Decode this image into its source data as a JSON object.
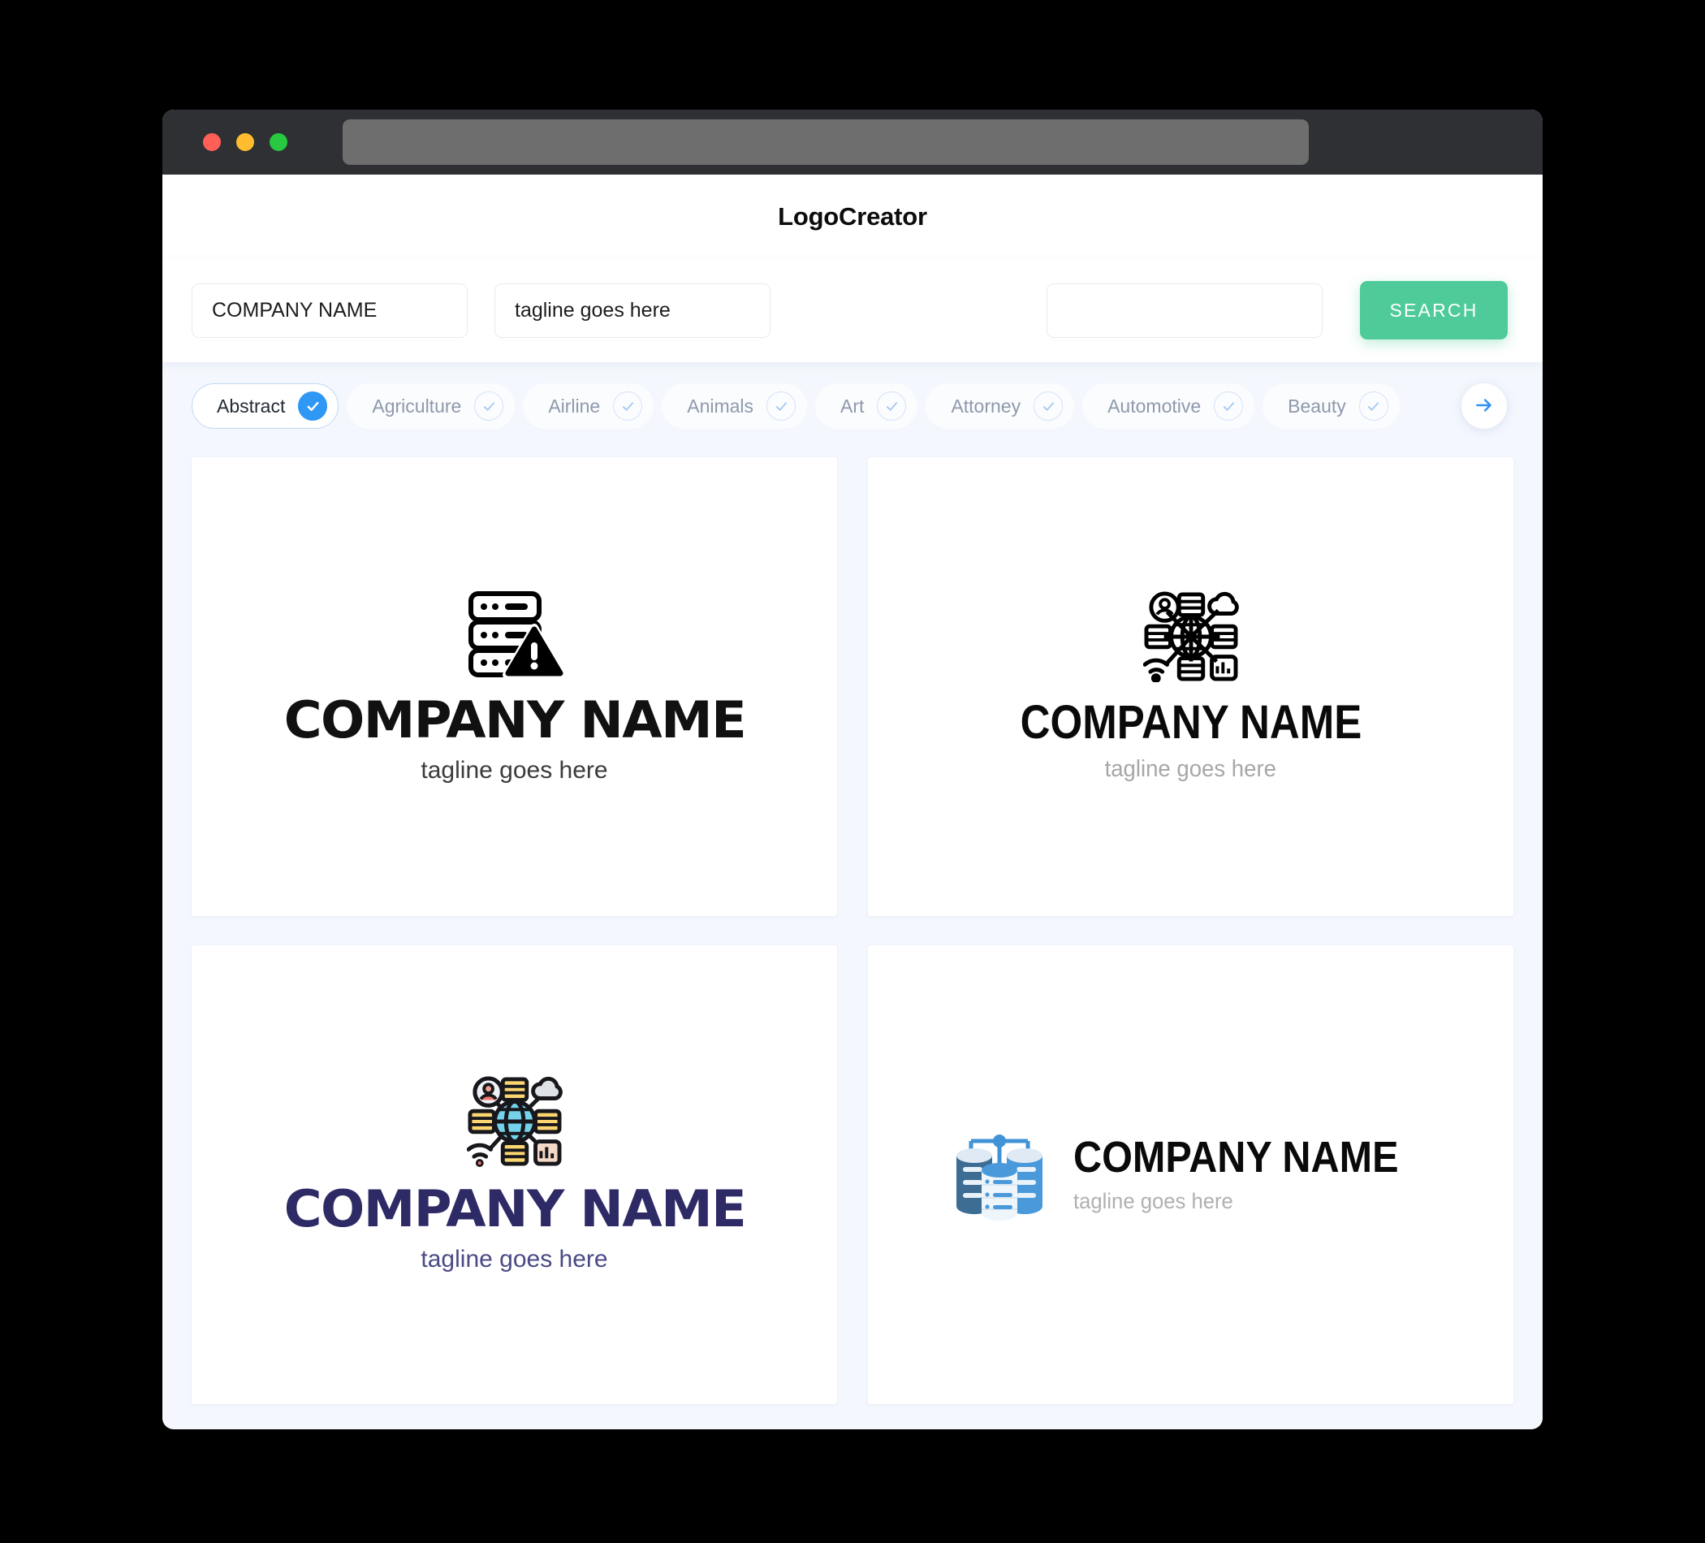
{
  "window": {
    "traffic_lights": [
      "close",
      "minimize",
      "zoom"
    ],
    "url_value": ""
  },
  "header": {
    "title": "LogoCreator"
  },
  "search": {
    "company_name": {
      "value": "COMPANY NAME",
      "placeholder": "COMPANY NAME"
    },
    "tagline": {
      "value": "tagline goes here",
      "placeholder": "tagline goes here"
    },
    "extra": {
      "value": "",
      "placeholder": ""
    },
    "search_label": "SEARCH",
    "accent_color": "#4ecb98"
  },
  "categories": {
    "items": [
      {
        "label": "Abstract",
        "selected": true
      },
      {
        "label": "Agriculture",
        "selected": false
      },
      {
        "label": "Airline",
        "selected": false
      },
      {
        "label": "Animals",
        "selected": false
      },
      {
        "label": "Art",
        "selected": false
      },
      {
        "label": "Attorney",
        "selected": false
      },
      {
        "label": "Automotive",
        "selected": false
      },
      {
        "label": "Beauty",
        "selected": false
      }
    ],
    "next_icon": "arrow-right-icon",
    "selected_color": "#2f97f4"
  },
  "results": {
    "cards": [
      {
        "mark": "server-warning-icon",
        "brand": "COMPANY NAME",
        "tagline": "tagline goes here",
        "brand_color": "#111111",
        "tagline_color": "#3b3b3b"
      },
      {
        "mark": "network-globe-icon",
        "brand": "COMPANY NAME",
        "tagline": "tagline goes here",
        "brand_color": "#0a0a0a",
        "tagline_color": "#a7a7a7"
      },
      {
        "mark": "network-globe-color-icon",
        "brand": "COMPANY NAME",
        "tagline": "tagline goes here",
        "brand_color": "#2d2a66",
        "tagline_color": "#4a4a86"
      },
      {
        "mark": "database-stack-icon",
        "brand": "COMPANY NAME",
        "tagline": "tagline goes here",
        "brand_color": "#0a0a0a",
        "tagline_color": "#b0b0b0"
      }
    ]
  }
}
